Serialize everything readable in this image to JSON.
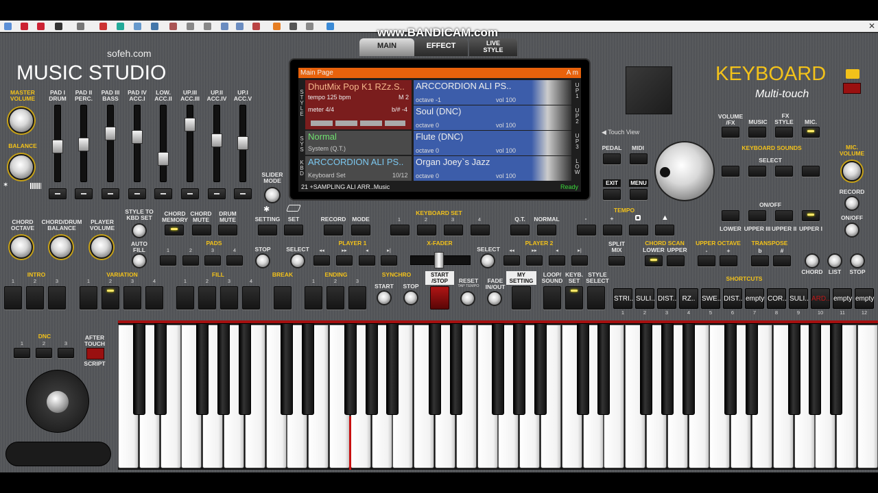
{
  "toolbar": {
    "close": "✕"
  },
  "watermark": "www.BANDICAM.com",
  "tabs": [
    "MAIN",
    "EFFECT",
    "LIVE STYLE"
  ],
  "brand": {
    "site": "sofeh.com",
    "title": "MUSIC STUDIO",
    "keyboard": "KEYBOARD",
    "multitouch": "Multi-touch"
  },
  "left": {
    "master": "MASTER VOLUME",
    "balance": "BALANCE",
    "chord_octave": "CHORD OCTAVE",
    "chord_drum": "CHORD/DRUM BALANCE",
    "player_volume": "PLAYER VOLUME"
  },
  "sliders": [
    "PAD I DRUM",
    "PAD II PERC.",
    "PAD III BASS",
    "PAD IV ACC.I",
    "LOW. ACC.II",
    "UP.III ACC.III",
    "UP.II ACC.IV",
    "UP.I ACC.V"
  ],
  "slider_levels": [
    0.55,
    0.52,
    0.35,
    0.4,
    0.75,
    0.2,
    0.45,
    0.5
  ],
  "slider_mode": "SLIDER MODE",
  "lcd": {
    "header": "Main Page",
    "header_right": "A m",
    "style_name": "DhutMix Pop K1 RZz.S..",
    "tempo": "tempo 125 bpm",
    "measure": "M 2",
    "meter": "meter 4/4",
    "transp": "b/# -4",
    "sys_name": "Normal",
    "sys_sub": "System (Q.T.)",
    "kbd_name": "ARCCORDION ALI PS..",
    "kbd_sub": "Keyboard Set",
    "kbd_count": "10/12",
    "parts": [
      {
        "name": "ARCCORDION ALI PS..",
        "octave": "octave -1",
        "vol": "vol 100"
      },
      {
        "name": "Soul (DNC)",
        "octave": "octave 0",
        "vol": "vol 100"
      },
      {
        "name": "Flute (DNC)",
        "octave": "octave 0",
        "vol": "vol 100"
      },
      {
        "name": "Organ Joey`s Jazz",
        "octave": "octave 0",
        "vol": "vol 100"
      }
    ],
    "tags": [
      "UP1",
      "UP2",
      "UP3",
      "LOW"
    ],
    "footer": "21 +SAMPLING ALI ARR..Music",
    "status": "Ready"
  },
  "right": {
    "touch_view": "Touch View",
    "volume_fx": "VOLUME /FX",
    "fx": "FX",
    "music": "MUSIC",
    "style": "STYLE",
    "mic": "MIC.",
    "pedal": "PEDAL",
    "midi": "MIDI",
    "keyboard_sounds": "KEYBOARD SOUNDS",
    "select": "SELECT",
    "onoff": "ON/OFF",
    "mic_volume": "MIC. VOLUME",
    "record": "RECORD",
    "onoff2": "ON/OFF",
    "exit": "EXIT",
    "menu": "MENU",
    "lower": "LOWER",
    "upper3": "UPPER III",
    "upper2": "UPPER II",
    "upper1": "UPPER I"
  },
  "mid": {
    "style_to_kbd": "STYLE TO KBD SET",
    "chord_memory": "CHORD MEMORY",
    "chord_mute": "CHORD MUTE",
    "drum_mute": "DRUM MUTE",
    "setting": "SETTING",
    "set": "SET",
    "record": "RECORD",
    "mode": "MODE",
    "keyboard_set": "KEYBOARD SET",
    "qt": "Q.T.",
    "normal": "NORMAL",
    "tempo": "TEMPO",
    "minus": "-",
    "plus": "+"
  },
  "row2": {
    "auto_fill": "AUTO FILL",
    "pads": "PADS",
    "stop": "STOP",
    "select": "SELECT",
    "player1": "PLAYER 1",
    "xfader": "X-FADER",
    "select2": "SELECT",
    "player2": "PLAYER 2",
    "split_mix": "SPLIT MIX",
    "chord_scan": "CHORD SCAN",
    "lower": "LOWER",
    "upper": "UPPER",
    "upper_octave": "UPPER OCTAVE",
    "transpose": "TRANSPOSE",
    "flat": "b",
    "sharp": "#",
    "chord": "CHORD",
    "list": "LIST",
    "stop2": "STOP"
  },
  "row3": {
    "intro": "INTRO",
    "variation": "VARIATION",
    "fill": "FILL",
    "break": "BREAK",
    "ending": "ENDING",
    "synchro": "SYNCHRO",
    "start": "START",
    "stop": "STOP",
    "start_stop": "START /STOP",
    "reset": "RESET",
    "tap": "TAP TEMPO",
    "fade": "FADE IN/OUT",
    "my_setting": "MY SETTING",
    "loop": "LOOP/ SOUND",
    "keyb_set": "KEYB. SET",
    "style_select": "STYLE SELECT",
    "shortcuts": "SHORTCUTS"
  },
  "shortcuts": [
    "STRI..",
    "SULI..",
    "DIST..",
    "RZ..",
    "SWE..",
    "DIST..",
    "empty",
    "COR..",
    "SULI..",
    "ARD..",
    "empty",
    "empty"
  ],
  "dnc": {
    "label": "DNC",
    "after_touch": "AFTER TOUCH",
    "script": "SCRIPT"
  },
  "colors": {
    "accent": "#f3c21a",
    "lcd_header": "#e8620c",
    "part_blue": "#3c5daa",
    "style_red": "#7a1d1d"
  }
}
